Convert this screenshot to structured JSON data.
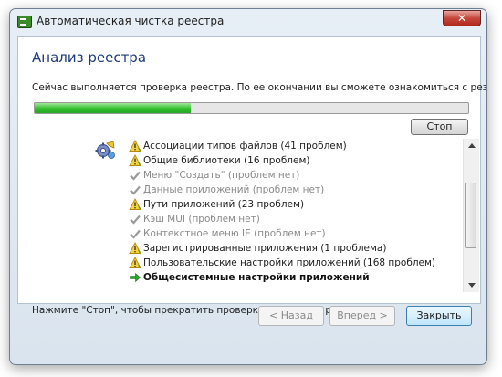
{
  "window": {
    "title": "Автоматическая чистка реестра",
    "close_label": "✕"
  },
  "header": {
    "heading": "Анализ реестра",
    "status": "Сейчас выполняется проверка реестра. По ее окончании вы сможете ознакомиться с результатами."
  },
  "progress": {
    "fraction": 0.36,
    "fill_color": "#2fbe2a"
  },
  "toolbar": {
    "stop_label": "Стоп"
  },
  "icons": {
    "scan": "registry-scan-gear-icon",
    "warning": "warning-triangle-icon",
    "done": "check-mark-icon",
    "current": "green-arrow-icon"
  },
  "items": [
    {
      "label": "Ассоциации типов файлов (41 проблем)",
      "state": "warn"
    },
    {
      "label": "Общие библиотеки (16 проблем)",
      "state": "warn"
    },
    {
      "label": "Меню \"Создать\" (проблем нет)",
      "state": "ok"
    },
    {
      "label": "Данные приложений (проблем нет)",
      "state": "ok"
    },
    {
      "label": "Пути приложений (23 проблем)",
      "state": "warn"
    },
    {
      "label": "Кэш MUI (проблем нет)",
      "state": "ok"
    },
    {
      "label": "Контекстное меню IE (проблем нет)",
      "state": "ok"
    },
    {
      "label": "Зарегистрированные приложения (1 проблема)",
      "state": "warn"
    },
    {
      "label": "Пользовательские настройки приложений (168 проблем)",
      "state": "warn"
    },
    {
      "label": "Общесистемные настройки приложений",
      "state": "current"
    }
  ],
  "hint": "Нажмите \"Стоп\", чтобы прекратить проверку и показать результаты.",
  "footer": {
    "back_label": "< Назад",
    "next_label": "Вперед >",
    "close_label": "Закрыть"
  }
}
